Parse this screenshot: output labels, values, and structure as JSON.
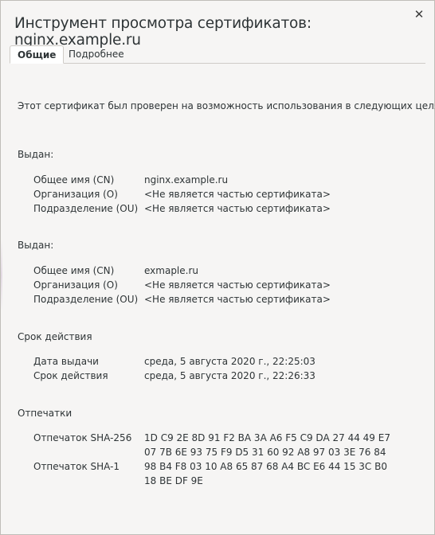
{
  "window": {
    "title": "Инструмент просмотра сертификатов: nginx.example.ru",
    "close_glyph": "✕"
  },
  "tabs": [
    {
      "label": "Общие",
      "active": true
    },
    {
      "label": "Подробнее",
      "active": false
    }
  ],
  "intro": "Этот сертификат был проверен на возможность использования в следующих целях:",
  "issued_to": {
    "heading": "Выдан:",
    "rows": [
      {
        "label": "Общее имя (CN)",
        "value": "nginx.example.ru"
      },
      {
        "label": "Организация (O)",
        "value": "<Не является частью сертификата>"
      },
      {
        "label": "Подразделение (OU)",
        "value": "<Не является частью сертификата>"
      }
    ]
  },
  "issued_by": {
    "heading": "Выдан:",
    "rows": [
      {
        "label": "Общее имя (CN)",
        "value": "exmaple.ru"
      },
      {
        "label": "Организация (O)",
        "value": "<Не является частью сертификата>"
      },
      {
        "label": "Подразделение (OU)",
        "value": "<Не является частью сертификата>"
      }
    ]
  },
  "validity": {
    "heading": "Срок действия",
    "rows": [
      {
        "label": "Дата выдачи",
        "value": "среда, 5 августа 2020 г., 22:25:03"
      },
      {
        "label": "Срок действия",
        "value": "среда, 5 августа 2020 г., 22:26:33"
      }
    ]
  },
  "fingerprints": {
    "heading": "Отпечатки",
    "sha256": {
      "label": "Отпечаток SHA-256",
      "line1": "1D C9 2E 8D 91 F2 BA 3A A6 F5 C9 DA 27 44 49 E7",
      "line2": "07 7B 6E 93 75 F9 D5 31 60 92 A8 97 03 3E 76 84"
    },
    "sha1": {
      "label": "Отпечаток SHA-1",
      "line1": "98 B4 F8 03 10 A8 65 87 68 A4 BC E6 44 15 3C B0",
      "line2": "18 BE DF 9E"
    }
  }
}
